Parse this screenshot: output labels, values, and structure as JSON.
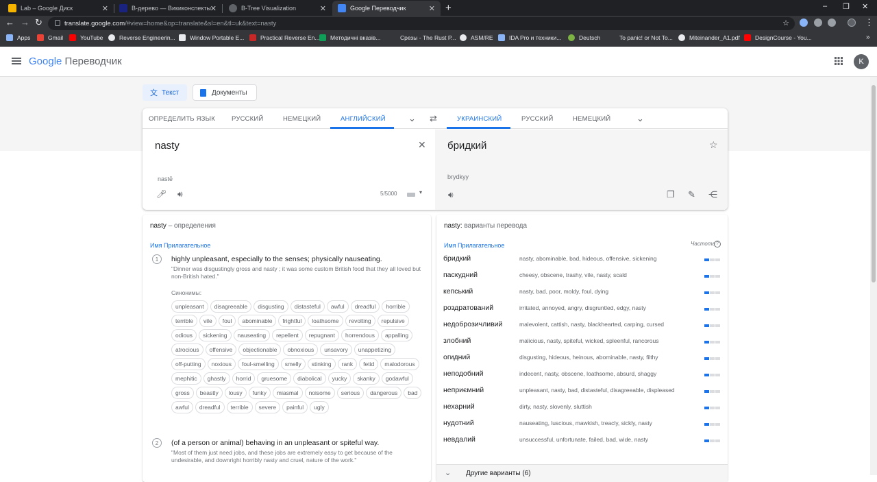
{
  "tabs": [
    {
      "title": "Lab – Google Диск",
      "fav": "#f4b400"
    },
    {
      "title": "B-дерево — Викиконспекты",
      "fav": "#1a237e"
    },
    {
      "title": "B-Tree Visualization",
      "fav": "#5f6368"
    },
    {
      "title": "Google Переводчик",
      "fav": "#4285f4"
    }
  ],
  "url": {
    "host": "translate.google.com",
    "path": "/#view=home&op=translate&sl=en&tl=uk&text=nasty"
  },
  "bookmarks": [
    "Apps",
    "Gmail",
    "YouTube",
    "Reverse Engineerin...",
    "Window Portable E...",
    "Practical Reverse En...",
    "Методичні вказів...",
    "Срезы - The Rust P...",
    "ASM/RE",
    "IDA Pro и техники...",
    "Deutsch",
    "To panic! or Not To...",
    "Miteinander_A1.pdf",
    "DesignCourse - You..."
  ],
  "app": {
    "logo_google": "Google",
    "logo_product": "Переводчик",
    "avatar": "K"
  },
  "modes": {
    "text": "Текст",
    "docs": "Документы"
  },
  "source_langs": [
    "ОПРЕДЕЛИТЬ ЯЗЫК",
    "РУССКИЙ",
    "НЕМЕЦКИЙ",
    "АНГЛИЙСКИЙ"
  ],
  "target_langs": [
    "УКРАИНСКИЙ",
    "РУССКИЙ",
    "НЕМЕЦКИЙ"
  ],
  "source": {
    "text": "nasty",
    "translit": "nastē",
    "count": "5/5000"
  },
  "target": {
    "text": "бридкий",
    "translit": "brydkyy"
  },
  "definitions": {
    "word": "nasty",
    "title_suffix": "– определения",
    "pos": "Имя Прилагательное",
    "synonyms_label": "Синонимы:",
    "items": [
      {
        "num": "1",
        "text": "highly unpleasant, especially to the senses; physically nauseating.",
        "example": "\"Dinner was disgustingly gross and nasty ; it was some custom British food that they all loved but non-British hated.\""
      },
      {
        "num": "2",
        "text": "(of a person or animal) behaving in an unpleasant or spiteful way.",
        "example": "\"Most of them just need jobs, and these jobs are extremely easy to get because of the undesirable, and downright horribly nasty and cruel, nature of the work.\""
      }
    ],
    "synonyms": [
      "unpleasant",
      "disagreeable",
      "disgusting",
      "distasteful",
      "awful",
      "dreadful",
      "horrible",
      "terrible",
      "vile",
      "foul",
      "abominable",
      "frightful",
      "loathsome",
      "revolting",
      "repulsive",
      "odious",
      "sickening",
      "nauseating",
      "repellent",
      "repugnant",
      "horrendous",
      "appalling",
      "atrocious",
      "offensive",
      "objectionable",
      "obnoxious",
      "unsavory",
      "unappetizing",
      "off-putting",
      "noxious",
      "foul-smelling",
      "smelly",
      "stinking",
      "rank",
      "fetid",
      "malodorous",
      "mephitic",
      "ghastly",
      "horrid",
      "gruesome",
      "diabolical",
      "yucky",
      "skanky",
      "godawful",
      "gross",
      "beastly",
      "lousy",
      "funky",
      "miasmal",
      "noisome",
      "serious",
      "dangerous",
      "bad",
      "awful",
      "dreadful",
      "terrible",
      "severe",
      "painful",
      "ugly"
    ]
  },
  "translations": {
    "word": "nasty:",
    "title_suffix": "варианты перевода",
    "pos": "Имя Прилагательное",
    "freq_label": "Частота",
    "more": "Другие варианты (6)",
    "rows": [
      {
        "w": "бридкий",
        "s": "nasty, abominable, bad, hideous, offensive, sickening",
        "f": 1
      },
      {
        "w": "паскудний",
        "s": "cheesy, obscene, trashy, vile, nasty, scald",
        "f": 1
      },
      {
        "w": "кепський",
        "s": "nasty, bad, poor, moldy, foul, dying",
        "f": 1
      },
      {
        "w": "роздратований",
        "s": "irritated, annoyed, angry, disgruntled, edgy, nasty",
        "f": 1
      },
      {
        "w": "недоброзичливий",
        "s": "malevolent, cattish, nasty, blackhearted, carping, cursed",
        "f": 1
      },
      {
        "w": "злобний",
        "s": "malicious, nasty, spiteful, wicked, spleenful, rancorous",
        "f": 1
      },
      {
        "w": "огидний",
        "s": "disgusting, hideous, heinous, abominable, nasty, filthy",
        "f": 1
      },
      {
        "w": "неподобний",
        "s": "indecent, nasty, obscene, loathsome, absurd, shaggy",
        "f": 1
      },
      {
        "w": "неприємний",
        "s": "unpleasant, nasty, bad, distasteful, disagreeable, displeased",
        "f": 1
      },
      {
        "w": "нехарний",
        "s": "dirty, nasty, slovenly, sluttish",
        "f": 1
      },
      {
        "w": "нудотний",
        "s": "nauseating, luscious, mawkish, treacly, sickly, nasty",
        "f": 1
      },
      {
        "w": "невдалий",
        "s": "unsuccessful, unfortunate, failed, bad, wide, nasty",
        "f": 1
      }
    ]
  }
}
